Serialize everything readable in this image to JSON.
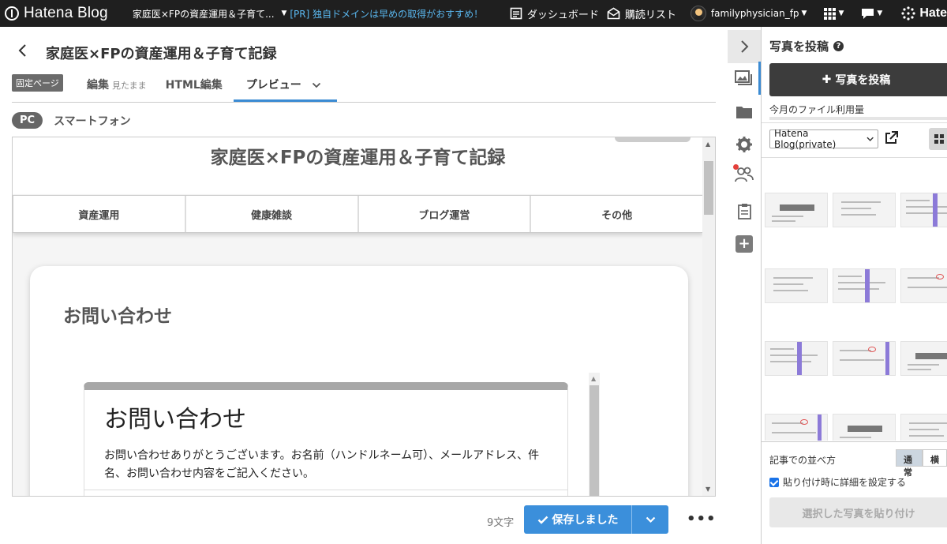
{
  "topbar": {
    "logo": "Hatena Blog",
    "blog_title": "家庭医×FPの資産運用＆子育て...",
    "promo": "[PR] 独自ドメインは早めの取得がおすすめ！",
    "dashboard": "ダッシュボード",
    "subscriptions": "購読リスト",
    "username": "familyphysician_fp",
    "hatena_right": "Hate"
  },
  "editor": {
    "title": "家庭医×FPの資産運用＆子育て記録",
    "page_badge": "固定ページ",
    "tabs": [
      {
        "label": "編集",
        "sub": "見たまま"
      },
      {
        "label": "HTML編集"
      },
      {
        "label": "プレビュー"
      }
    ],
    "device_tabs": [
      "PC",
      "スマートフォン"
    ]
  },
  "preview": {
    "blog_title": "家庭医×FPの資産運用＆子育て記録",
    "nav": [
      "資産運用",
      "健康雑談",
      "ブログ運営",
      "その他"
    ],
    "card_title": "お問い合わせ",
    "form_title": "お問い合わせ",
    "form_desc": "お問い合わせありがとうございます。お名前（ハンドルネーム可）、メールアドレス、件名、お問い合わせ内容をご記入ください。"
  },
  "bottom": {
    "char_count": "9文字",
    "save_label": "保存しました"
  },
  "panel": {
    "title": "写真を投稿",
    "upload_button": "写真を投稿",
    "usage_label": "今月のファイル利用量",
    "usage_fraction": 0.0,
    "album_select": "Hatena Blog(private)",
    "sort_label": "記事での並べ方",
    "sort_options": [
      "通常",
      "横"
    ],
    "detail_checkbox": "貼り付け時に詳細を設定する",
    "paste_button": "選択した写真を貼り付け"
  },
  "colors": {
    "accent": "#3b8fdb",
    "topbar": "#1f1f1f",
    "promo": "#5ab8f0"
  }
}
